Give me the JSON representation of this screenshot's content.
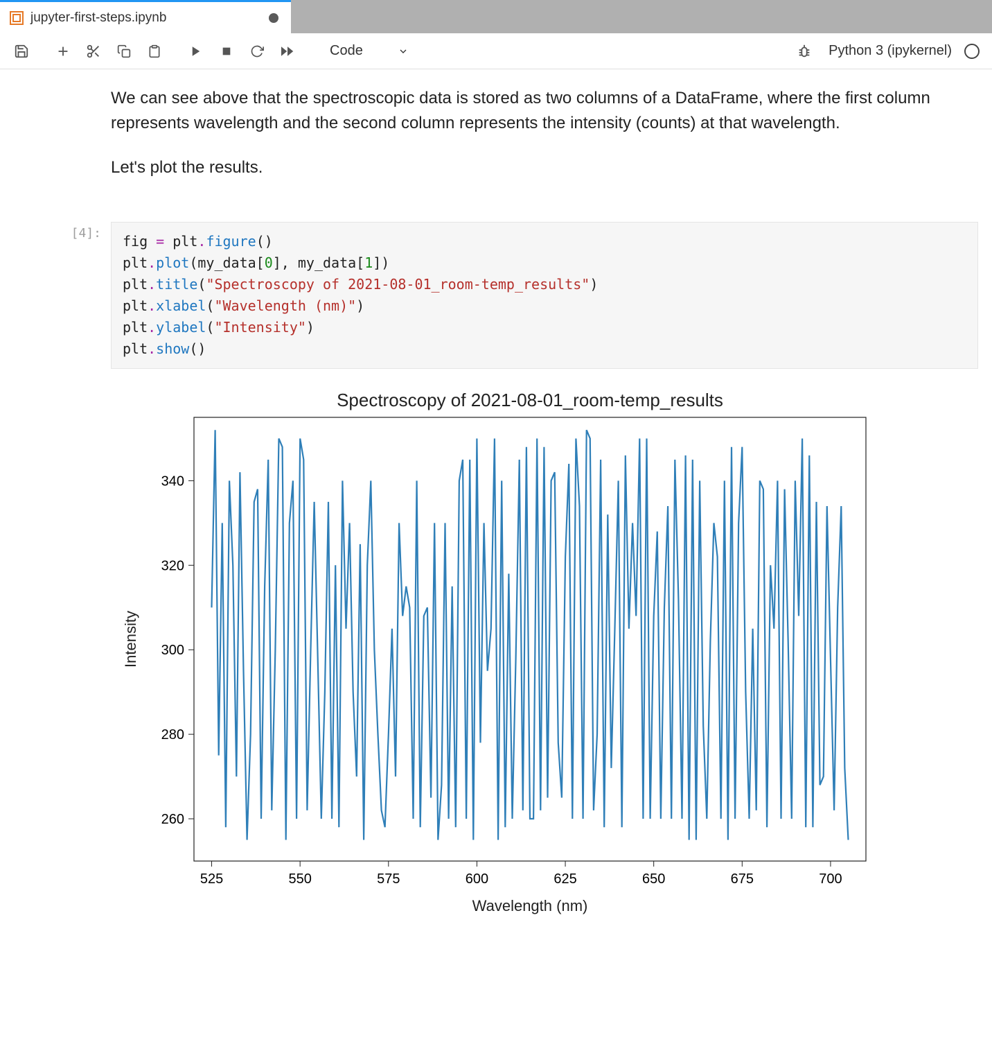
{
  "tab": {
    "title": "jupyter-first-steps.ipynb",
    "dirty": true
  },
  "toolbar": {
    "cell_type_label": "Code",
    "kernel_label": "Python 3 (ipykernel)"
  },
  "markdown": {
    "p1": "We can see above that the spectroscopic data is stored as two columns of a DataFrame, where the first column represents wavelength and the second column represents the intensity (counts) at that wavelength.",
    "p2": "Let's plot the results."
  },
  "code_cell": {
    "prompt": "[4]:",
    "lines": [
      [
        {
          "t": "fig ",
          "c": "name"
        },
        {
          "t": "=",
          "c": "op"
        },
        {
          "t": " plt",
          "c": "name"
        },
        {
          "t": ".",
          "c": "dot"
        },
        {
          "t": "figure",
          "c": "func"
        },
        {
          "t": "()",
          "c": "paren"
        }
      ],
      [
        {
          "t": "plt",
          "c": "name"
        },
        {
          "t": ".",
          "c": "dot"
        },
        {
          "t": "plot",
          "c": "func"
        },
        {
          "t": "(my_data[",
          "c": "paren"
        },
        {
          "t": "0",
          "c": "num"
        },
        {
          "t": "], my_data[",
          "c": "paren"
        },
        {
          "t": "1",
          "c": "num"
        },
        {
          "t": "])",
          "c": "paren"
        }
      ],
      [
        {
          "t": "plt",
          "c": "name"
        },
        {
          "t": ".",
          "c": "dot"
        },
        {
          "t": "title",
          "c": "func"
        },
        {
          "t": "(",
          "c": "paren"
        },
        {
          "t": "\"Spectroscopy of 2021-08-01_room-temp_results\"",
          "c": "str"
        },
        {
          "t": ")",
          "c": "paren"
        }
      ],
      [
        {
          "t": "plt",
          "c": "name"
        },
        {
          "t": ".",
          "c": "dot"
        },
        {
          "t": "xlabel",
          "c": "func"
        },
        {
          "t": "(",
          "c": "paren"
        },
        {
          "t": "\"Wavelength (nm)\"",
          "c": "str"
        },
        {
          "t": ")",
          "c": "paren"
        }
      ],
      [
        {
          "t": "plt",
          "c": "name"
        },
        {
          "t": ".",
          "c": "dot"
        },
        {
          "t": "ylabel",
          "c": "func"
        },
        {
          "t": "(",
          "c": "paren"
        },
        {
          "t": "\"Intensity\"",
          "c": "str"
        },
        {
          "t": ")",
          "c": "paren"
        }
      ],
      [
        {
          "t": "plt",
          "c": "name"
        },
        {
          "t": ".",
          "c": "dot"
        },
        {
          "t": "show",
          "c": "func"
        },
        {
          "t": "()",
          "c": "paren"
        }
      ]
    ]
  },
  "chart_data": {
    "type": "line",
    "title": "Spectroscopy of 2021-08-01_room-temp_results",
    "xlabel": "Wavelength (nm)",
    "ylabel": "Intensity",
    "xlim": [
      520,
      710
    ],
    "ylim": [
      250,
      355
    ],
    "xticks": [
      525,
      550,
      575,
      600,
      625,
      650,
      675,
      700
    ],
    "yticks": [
      260,
      280,
      300,
      320,
      340
    ],
    "line_color": "#2f7fb8",
    "x": [
      525,
      526,
      527,
      528,
      529,
      530,
      531,
      532,
      533,
      534,
      535,
      536,
      537,
      538,
      539,
      540,
      541,
      542,
      543,
      544,
      545,
      546,
      547,
      548,
      549,
      550,
      551,
      552,
      553,
      554,
      555,
      556,
      557,
      558,
      559,
      560,
      561,
      562,
      563,
      564,
      565,
      566,
      567,
      568,
      569,
      570,
      571,
      572,
      573,
      574,
      575,
      576,
      577,
      578,
      579,
      580,
      581,
      582,
      583,
      584,
      585,
      586,
      587,
      588,
      589,
      590,
      591,
      592,
      593,
      594,
      595,
      596,
      597,
      598,
      599,
      600,
      601,
      602,
      603,
      604,
      605,
      606,
      607,
      608,
      609,
      610,
      611,
      612,
      613,
      614,
      615,
      616,
      617,
      618,
      619,
      620,
      621,
      622,
      623,
      624,
      625,
      626,
      627,
      628,
      629,
      630,
      631,
      632,
      633,
      634,
      635,
      636,
      637,
      638,
      639,
      640,
      641,
      642,
      643,
      644,
      645,
      646,
      647,
      648,
      649,
      650,
      651,
      652,
      653,
      654,
      655,
      656,
      657,
      658,
      659,
      660,
      661,
      662,
      663,
      664,
      665,
      666,
      667,
      668,
      669,
      670,
      671,
      672,
      673,
      674,
      675,
      676,
      677,
      678,
      679,
      680,
      681,
      682,
      683,
      684,
      685,
      686,
      687,
      688,
      689,
      690,
      691,
      692,
      693,
      694,
      695,
      696,
      697,
      698,
      699,
      700,
      701,
      702,
      703,
      704,
      705
    ],
    "y": [
      310,
      352,
      275,
      330,
      258,
      340,
      320,
      270,
      342,
      295,
      255,
      280,
      335,
      338,
      260,
      315,
      345,
      262,
      300,
      350,
      348,
      255,
      330,
      340,
      260,
      350,
      345,
      262,
      300,
      335,
      298,
      260,
      290,
      335,
      260,
      320,
      258,
      340,
      305,
      330,
      290,
      270,
      325,
      255,
      320,
      340,
      300,
      280,
      262,
      258,
      280,
      305,
      270,
      330,
      308,
      315,
      310,
      260,
      340,
      258,
      308,
      310,
      265,
      330,
      255,
      268,
      330,
      260,
      315,
      258,
      340,
      345,
      260,
      345,
      255,
      350,
      278,
      330,
      295,
      305,
      350,
      255,
      340,
      258,
      318,
      260,
      298,
      345,
      262,
      348,
      260,
      260,
      350,
      262,
      348,
      265,
      340,
      342,
      278,
      265,
      322,
      344,
      260,
      350,
      334,
      260,
      352,
      350,
      262,
      280,
      345,
      258,
      332,
      272,
      305,
      340,
      258,
      346,
      305,
      330,
      308,
      350,
      260,
      350,
      260,
      308,
      328,
      260,
      310,
      334,
      260,
      345,
      312,
      260,
      346,
      255,
      345,
      255,
      340,
      282,
      260,
      302,
      330,
      322,
      260,
      340,
      255,
      348,
      260,
      330,
      348,
      290,
      260,
      305,
      262,
      340,
      338,
      258,
      320,
      305,
      340,
      260,
      338,
      302,
      260,
      340,
      308,
      350,
      258,
      346,
      258,
      335,
      268,
      270,
      334,
      298,
      262,
      310,
      334,
      272,
      255
    ]
  }
}
